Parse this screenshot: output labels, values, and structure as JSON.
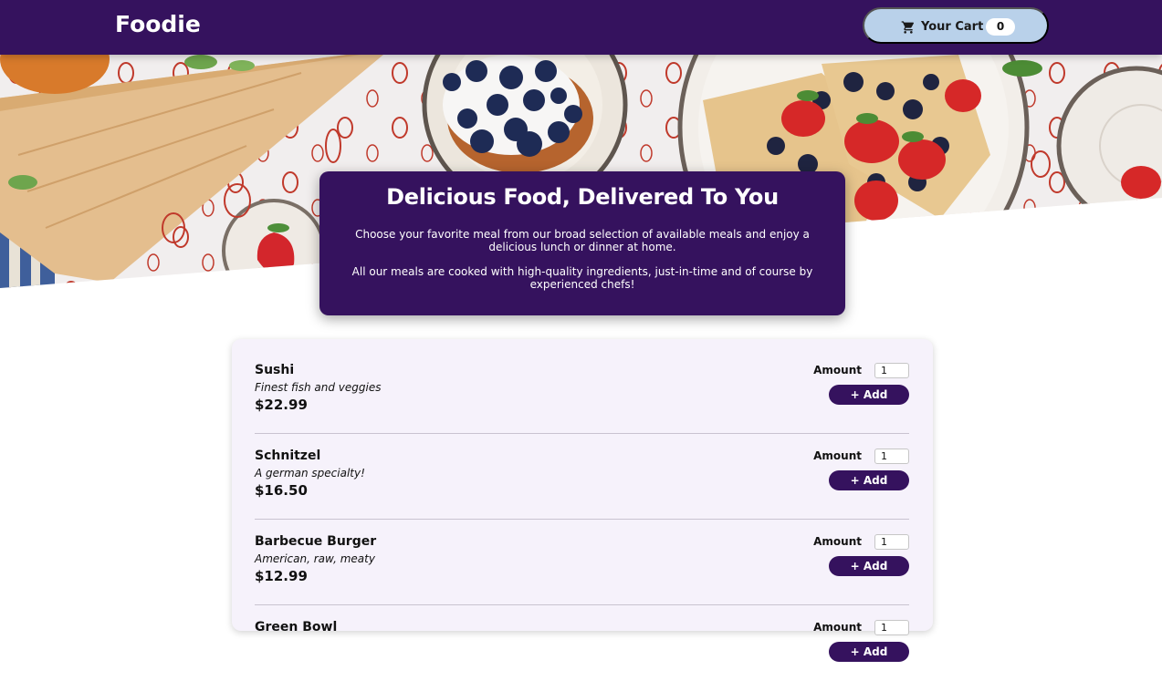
{
  "header": {
    "brand": "Foodie",
    "cart_label": "Your Cart",
    "cart_count": "0",
    "cart_icon": "shopping-cart-icon"
  },
  "summary": {
    "title": "Delicious Food, Delivered To You",
    "paragraph_1": "Choose your favorite meal from our broad selection of available meals and enjoy a delicious lunch or dinner at home.",
    "paragraph_2": "All our meals are cooked with high-quality ingredients, just-in-time and of course by experienced chefs!"
  },
  "meals": [
    {
      "name": "Sushi",
      "description": "Finest fish and veggies",
      "price": "$22.99",
      "amount_label": "Amount",
      "amount": "1",
      "add_label": "+ Add"
    },
    {
      "name": "Schnitzel",
      "description": "A german specialty!",
      "price": "$16.50",
      "amount_label": "Amount",
      "amount": "1",
      "add_label": "+ Add"
    },
    {
      "name": "Barbecue Burger",
      "description": "American, raw, meaty",
      "price": "$12.99",
      "amount_label": "Amount",
      "amount": "1",
      "add_label": "+ Add"
    },
    {
      "name": "Green Bowl",
      "description": "",
      "price": "",
      "amount_label": "Amount",
      "amount": "1",
      "add_label": "+ Add"
    }
  ],
  "colors": {
    "header_bg": "#35125e",
    "cart_bg": "#b9d1ea",
    "card_bg": "#f6f2fb",
    "accent": "#35125e"
  }
}
